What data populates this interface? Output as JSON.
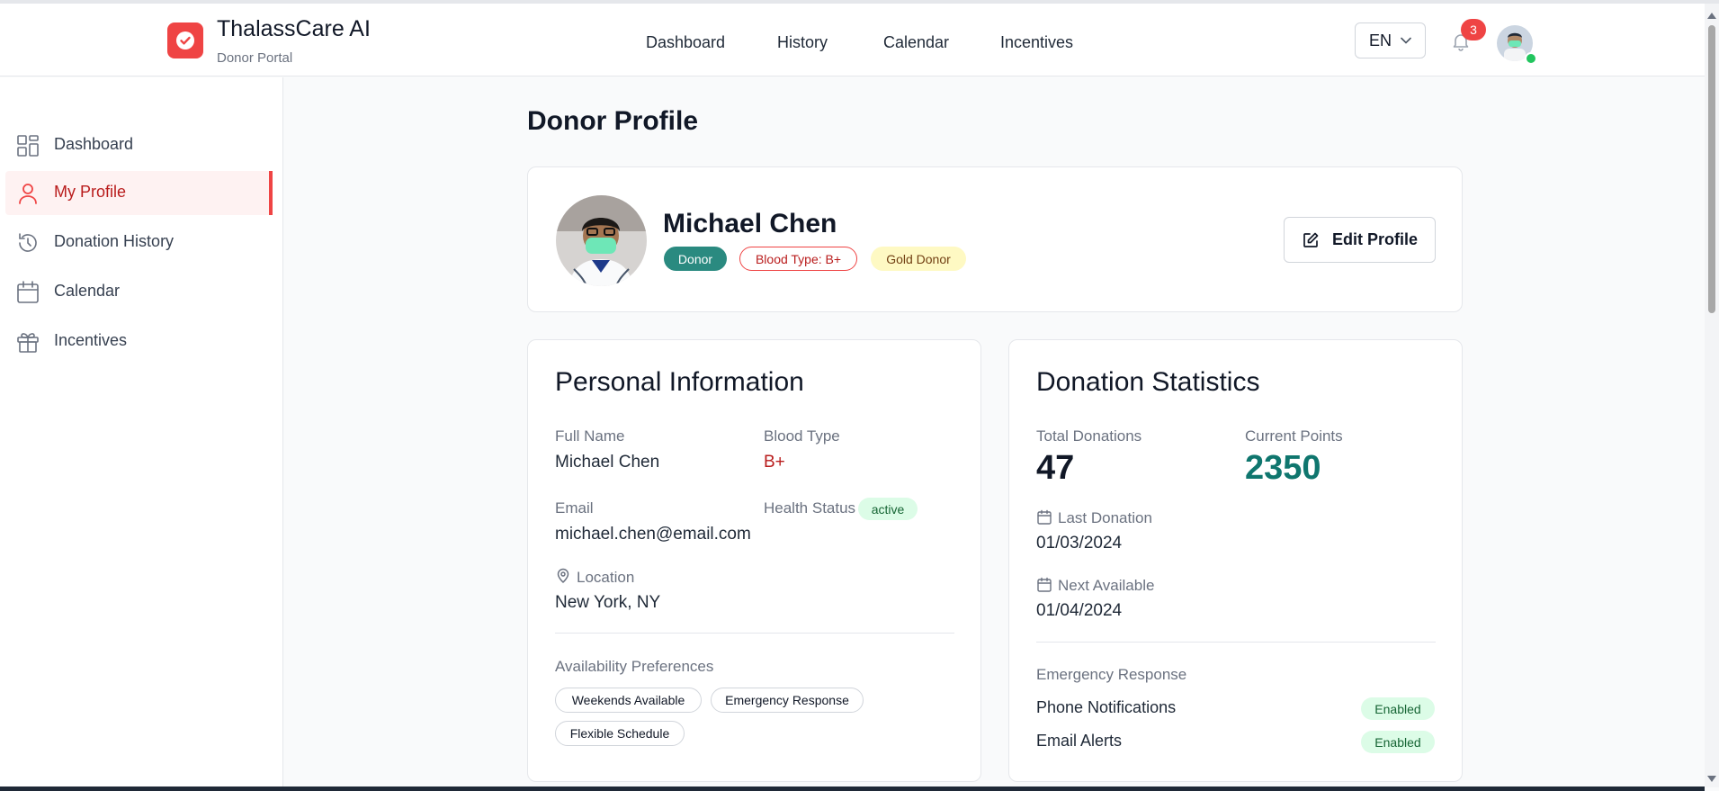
{
  "app": {
    "title": "ThalassCare AI",
    "subtitle": "Donor Portal",
    "brand_color": "#ef4444"
  },
  "topnav": {
    "items": [
      "Dashboard",
      "History",
      "Calendar",
      "Incentives"
    ]
  },
  "header": {
    "language": "EN",
    "notifications_count": "3"
  },
  "sidebar": {
    "items": [
      {
        "label": "Dashboard",
        "icon": "dashboard-icon"
      },
      {
        "label": "My Profile",
        "icon": "user-icon"
      },
      {
        "label": "Donation History",
        "icon": "history-icon"
      },
      {
        "label": "Calendar",
        "icon": "calendar-icon"
      },
      {
        "label": "Incentives",
        "icon": "gift-icon"
      }
    ],
    "active_index": 1
  },
  "page": {
    "title": "Donor Profile"
  },
  "profile": {
    "name": "Michael Chen",
    "badges": [
      "Donor",
      "Blood Type: B+",
      "Gold Donor"
    ],
    "edit_label": "Edit Profile"
  },
  "personal": {
    "title": "Personal Information",
    "full_name_label": "Full Name",
    "full_name": "Michael Chen",
    "blood_type_label": "Blood Type",
    "blood_type": "B+",
    "email_label": "Email",
    "email": "michael.chen@email.com",
    "health_status_label": "Health Status",
    "health_status": "active",
    "location_label": "Location",
    "location": "New York, NY",
    "availability_label": "Availability Preferences",
    "availability": [
      "Weekends Available",
      "Emergency Response",
      "Flexible Schedule"
    ]
  },
  "stats": {
    "title": "Donation Statistics",
    "total_label": "Total Donations",
    "total": "47",
    "points_label": "Current Points",
    "points": "2350",
    "last_label": "Last Donation",
    "last": "01/03/2024",
    "next_label": "Next Available",
    "next": "01/04/2024",
    "emergency_label": "Emergency Response",
    "phone_label": "Phone Notifications",
    "phone_status": "Enabled",
    "email_label": "Email Alerts",
    "email_status": "Enabled"
  }
}
